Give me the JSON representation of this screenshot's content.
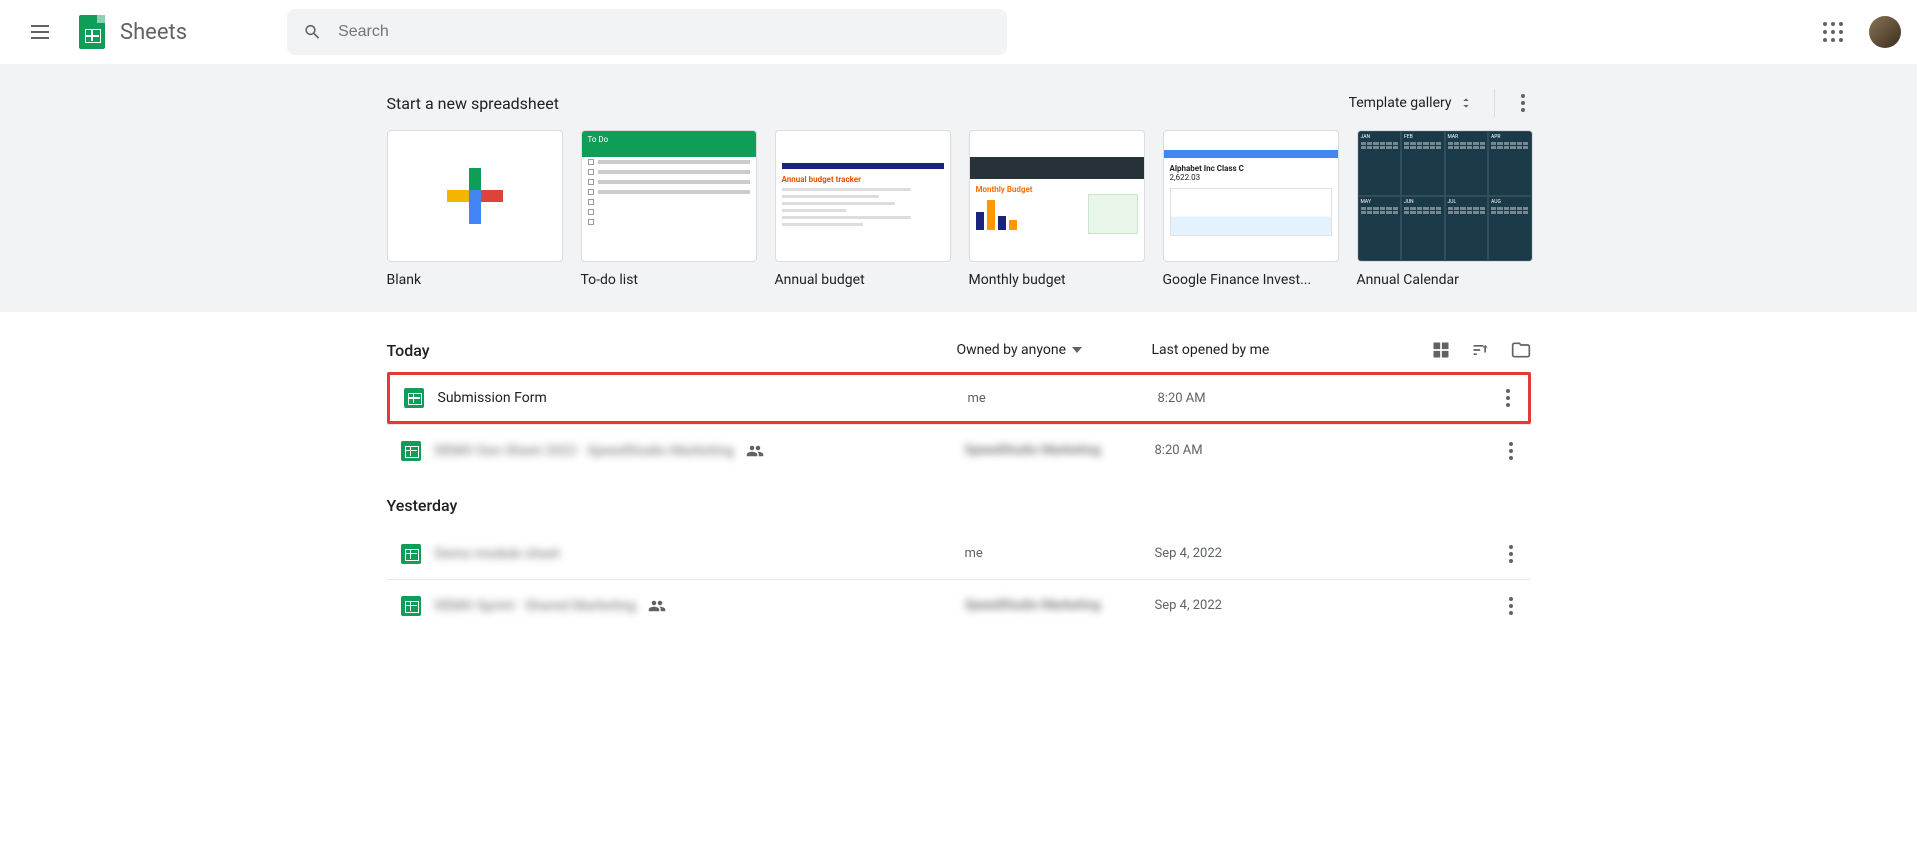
{
  "header": {
    "brand": "Sheets",
    "search_placeholder": "Search"
  },
  "templates": {
    "section_title": "Start a new spreadsheet",
    "gallery_label": "Template gallery",
    "items": [
      {
        "label": "Blank"
      },
      {
        "label": "To-do list"
      },
      {
        "label": "Annual budget"
      },
      {
        "label": "Monthly budget"
      },
      {
        "label": "Google Finance Invest..."
      },
      {
        "label": "Annual Calendar"
      }
    ],
    "thumb_text": {
      "todo": "To Do",
      "annual": "Annual budget tracker",
      "monthly": "Monthly Budget",
      "finance_name": "Alphabet Inc Class C",
      "finance_price": "2,622.03"
    }
  },
  "files": {
    "owner_filter": "Owned by anyone",
    "sort_label": "Last opened by me",
    "sections": [
      {
        "heading": "Today",
        "rows": [
          {
            "name": "Submission Form",
            "owner": "me",
            "date": "8:20 AM",
            "highlighted": true,
            "blurred": false,
            "shared": false
          },
          {
            "name": "DEMO Gen Sheet 2022 · SpeedStudio Marketing",
            "owner": "SpeedStudio Marketing",
            "date": "8:20 AM",
            "highlighted": false,
            "blurred": true,
            "shared": true
          }
        ]
      },
      {
        "heading": "Yesterday",
        "rows": [
          {
            "name": "Demo module sheet",
            "owner": "me",
            "date": "Sep 4, 2022",
            "highlighted": false,
            "blurred": true,
            "shared": false
          },
          {
            "name": "DEMO Sprint · Shared Marketing",
            "owner": "SpeedStudio Marketing",
            "date": "Sep 4, 2022",
            "highlighted": false,
            "blurred": true,
            "shared": true
          }
        ]
      }
    ]
  }
}
